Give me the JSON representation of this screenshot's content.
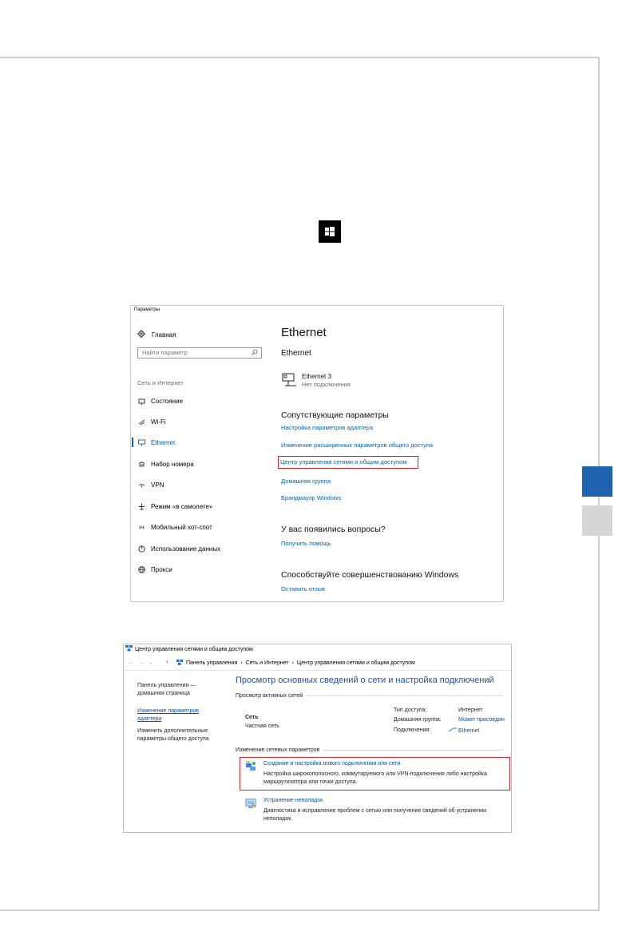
{
  "settings": {
    "window_title": "Параметры",
    "home": "Главная",
    "search_placeholder": "Найти параметр",
    "section": "Сеть и Интернет",
    "nav": [
      "Состояние",
      "Wi-Fi",
      "Ethernet",
      "Набор номера",
      "VPN",
      "Режим «в самолете»",
      "Мобильный хот-спот",
      "Использование данных",
      "Прокси"
    ],
    "active_nav": "Ethernet",
    "page_title": "Ethernet",
    "subtitle": "Ethernet",
    "adapter_name": "Ethernet 3",
    "adapter_status": "Нет подключения",
    "related_heading": "Сопутствующие параметры",
    "related_links": [
      "Настройка параметров адаптера",
      "Изменение расширенных параметров общего доступа",
      "Центр управления сетями и общим доступом",
      "Домашняя группа",
      "Брандмауэр Windows"
    ],
    "questions_heading": "У вас появились вопросы?",
    "help_link": "Получить помощь",
    "improve_heading": "Способствуйте совершенствованию Windows",
    "feedback_link": "Оставить отзыв"
  },
  "control_panel": {
    "window_title": "Центр управления сетями и общим доступом",
    "breadcrumbs": [
      "Панель управления",
      "Сеть и Интернет",
      "Центр управления сетями и общим доступом"
    ],
    "left_home": "Панель управления — домашняя страница",
    "left_adapter_link": "Изменение параметров адаптера",
    "left_sharing": "Изменить дополнительные параметры общего доступа",
    "heading": "Просмотр основных сведений о сети и настройка подключений",
    "active_networks_label": "Просмотр активных сетей",
    "network_name": "Сеть",
    "network_type": "Частная сеть",
    "access_type_label": "Тип доступа:",
    "access_type_value": "Интернет",
    "homegroup_label": "Домашняя группа:",
    "homegroup_value": "Может присоедин",
    "connections_label": "Подключения:",
    "connections_value": "Ethernet",
    "change_settings_label": "Изменение сетевых параметров",
    "task1_title": "Создание и настройка нового подключения или сети",
    "task1_desc": "Настройка широкополосного, коммутируемого или VPN-подключения либо настройка маршрутизатора или точки доступа.",
    "task2_title": "Устранение неполадок",
    "task2_desc": "Диагностика и исправление проблем с сетью или получение сведений об устранении неполадок."
  },
  "colors": {
    "accent_blue": "#1f62ad",
    "highlight_red": "#c9252c",
    "link_blue": "#0063b1"
  }
}
